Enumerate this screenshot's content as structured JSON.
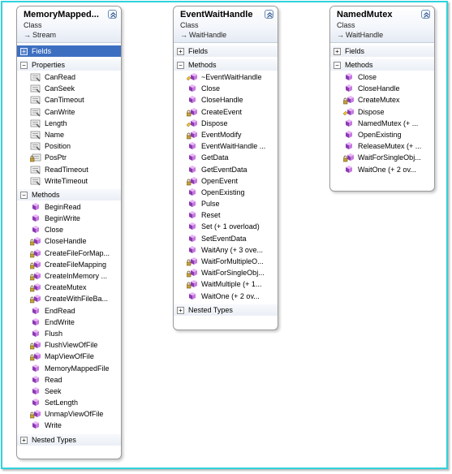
{
  "classes": [
    {
      "name": "MemoryMapped...",
      "kind": "Class",
      "base": "Stream",
      "sections": [
        {
          "label": "Fields",
          "expanded": false,
          "selected": true,
          "items": []
        },
        {
          "label": "Properties",
          "expanded": true,
          "selected": false,
          "items": [
            {
              "label": "CanRead",
              "icon": "property-icon"
            },
            {
              "label": "CanSeek",
              "icon": "property-icon"
            },
            {
              "label": "CanTimeout",
              "icon": "property-icon"
            },
            {
              "label": "CanWrite",
              "icon": "property-icon"
            },
            {
              "label": "Length",
              "icon": "property-icon"
            },
            {
              "label": "Name",
              "icon": "property-icon"
            },
            {
              "label": "Position",
              "icon": "property-icon"
            },
            {
              "label": "PosPtr",
              "icon": "protected-property-icon"
            },
            {
              "label": "ReadTimeout",
              "icon": "property-icon"
            },
            {
              "label": "WriteTimeout",
              "icon": "property-icon"
            }
          ]
        },
        {
          "label": "Methods",
          "expanded": true,
          "selected": false,
          "items": [
            {
              "label": "BeginRead",
              "icon": "method-icon"
            },
            {
              "label": "BeginWrite",
              "icon": "method-icon"
            },
            {
              "label": "Close",
              "icon": "method-icon"
            },
            {
              "label": "CloseHandle",
              "icon": "private-method-icon"
            },
            {
              "label": "CreateFileForMap...",
              "icon": "private-method-icon"
            },
            {
              "label": "CreateFileMapping",
              "icon": "private-method-icon"
            },
            {
              "label": "CreateInMemory ...",
              "icon": "private-method-icon"
            },
            {
              "label": "CreateMutex",
              "icon": "private-method-icon"
            },
            {
              "label": "CreateWithFileBa...",
              "icon": "private-method-icon"
            },
            {
              "label": "EndRead",
              "icon": "method-icon"
            },
            {
              "label": "EndWrite",
              "icon": "method-icon"
            },
            {
              "label": "Flush",
              "icon": "method-icon"
            },
            {
              "label": "FlushViewOfFile",
              "icon": "private-method-icon"
            },
            {
              "label": "MapViewOfFile",
              "icon": "private-method-icon"
            },
            {
              "label": "MemoryMappedFile",
              "icon": "method-icon"
            },
            {
              "label": "Read",
              "icon": "method-icon"
            },
            {
              "label": "Seek",
              "icon": "method-icon"
            },
            {
              "label": "SetLength",
              "icon": "method-icon"
            },
            {
              "label": "UnmapViewOfFile",
              "icon": "private-method-icon"
            },
            {
              "label": "Write",
              "icon": "method-icon"
            }
          ]
        },
        {
          "label": "Nested Types",
          "expanded": false,
          "selected": false,
          "items": []
        }
      ]
    },
    {
      "name": "EventWaitHandle",
      "kind": "Class",
      "base": "WaitHandle",
      "sections": [
        {
          "label": "Fields",
          "expanded": false,
          "selected": false,
          "items": []
        },
        {
          "label": "Methods",
          "expanded": true,
          "selected": false,
          "items": [
            {
              "label": "~EventWaitHandle",
              "icon": "protected-method-icon"
            },
            {
              "label": "Close",
              "icon": "method-icon"
            },
            {
              "label": "CloseHandle",
              "icon": "method-icon"
            },
            {
              "label": "CreateEvent",
              "icon": "private-method-icon"
            },
            {
              "label": "Dispose",
              "icon": "protected-method-icon"
            },
            {
              "label": "EventModify",
              "icon": "private-method-icon"
            },
            {
              "label": "EventWaitHandle ...",
              "icon": "method-icon"
            },
            {
              "label": "GetData",
              "icon": "method-icon"
            },
            {
              "label": "GetEventData",
              "icon": "method-icon"
            },
            {
              "label": "OpenEvent",
              "icon": "private-method-icon"
            },
            {
              "label": "OpenExisting",
              "icon": "method-icon"
            },
            {
              "label": "Pulse",
              "icon": "method-icon"
            },
            {
              "label": "Reset",
              "icon": "method-icon"
            },
            {
              "label": "Set (+ 1 overload)",
              "icon": "method-icon"
            },
            {
              "label": "SetEventData",
              "icon": "method-icon"
            },
            {
              "label": "WaitAny (+ 3 ove...",
              "icon": "method-icon"
            },
            {
              "label": "WaitForMultipleO...",
              "icon": "private-method-icon"
            },
            {
              "label": "WaitForSingleObj...",
              "icon": "private-method-icon"
            },
            {
              "label": "WaitMultiple  (+ 1...",
              "icon": "private-method-icon"
            },
            {
              "label": "WaitOne (+ 2 ov...",
              "icon": "method-icon"
            }
          ]
        },
        {
          "label": "Nested Types",
          "expanded": false,
          "selected": false,
          "items": []
        }
      ]
    },
    {
      "name": "NamedMutex",
      "kind": "Class",
      "base": "WaitHandle",
      "sections": [
        {
          "label": "Fields",
          "expanded": false,
          "selected": false,
          "items": []
        },
        {
          "label": "Methods",
          "expanded": true,
          "selected": false,
          "items": [
            {
              "label": "Close",
              "icon": "method-icon"
            },
            {
              "label": "CloseHandle",
              "icon": "method-icon"
            },
            {
              "label": "CreateMutex",
              "icon": "private-method-icon"
            },
            {
              "label": "Dispose",
              "icon": "protected-method-icon"
            },
            {
              "label": "NamedMutex  (+ ...",
              "icon": "method-icon"
            },
            {
              "label": "OpenExisting",
              "icon": "method-icon"
            },
            {
              "label": "ReleaseMutex  (+ ...",
              "icon": "method-icon"
            },
            {
              "label": "WaitForSingleObj...",
              "icon": "private-method-icon"
            },
            {
              "label": "WaitOne (+ 2 ov...",
              "icon": "method-icon"
            }
          ]
        }
      ]
    }
  ],
  "colors": {
    "frame_border": "#2fd3dc",
    "selected_section": "#3d6fc1",
    "method_icon": "#b95bd3",
    "property_icon": "#a8a8a8"
  }
}
